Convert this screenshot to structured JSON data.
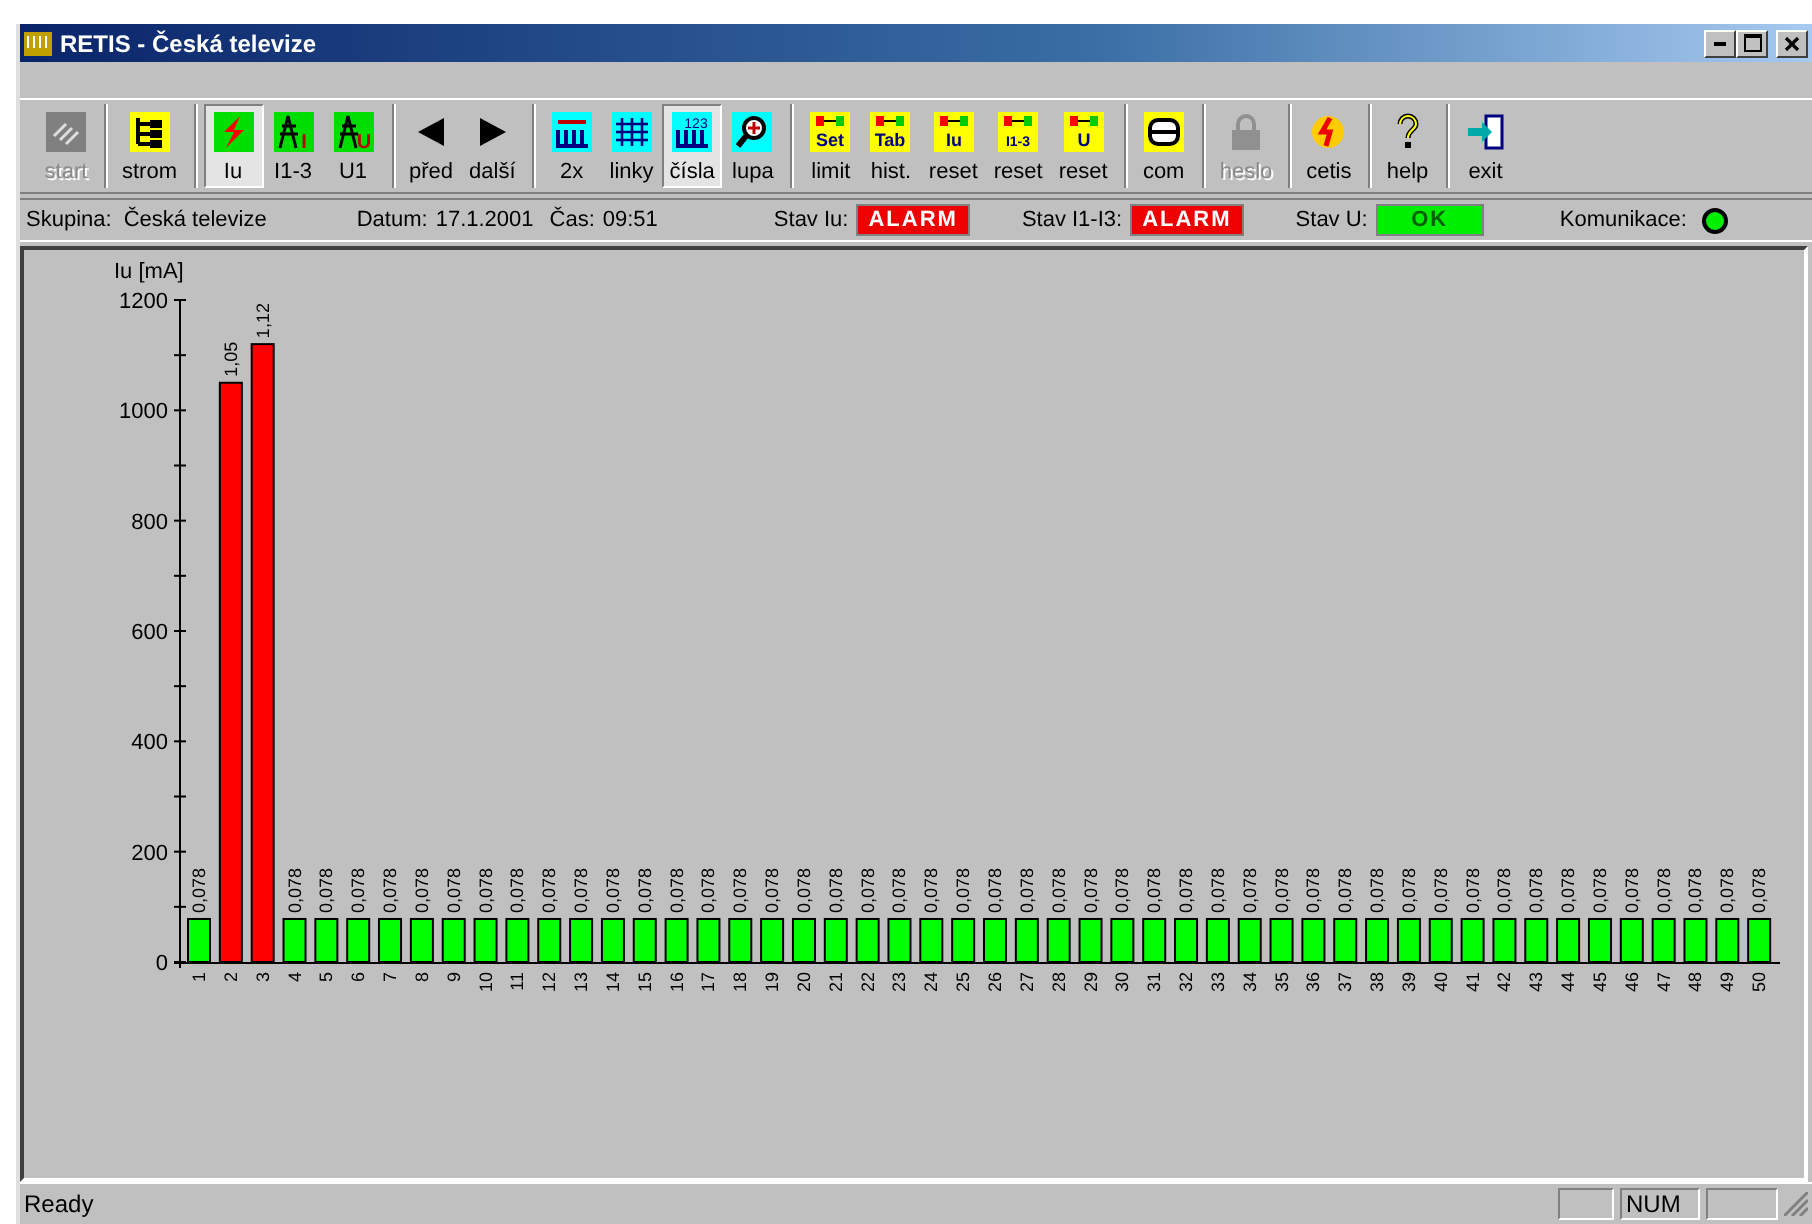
{
  "window": {
    "title": "RETIS - Česká televize"
  },
  "toolbar": [
    {
      "buttons": [
        {
          "label": "start",
          "pressed": false,
          "disabled": true
        }
      ]
    },
    {
      "buttons": [
        {
          "label": "strom",
          "pressed": false,
          "disabled": false
        }
      ]
    },
    {
      "buttons": [
        {
          "label": "Iu",
          "pressed": true,
          "disabled": false
        },
        {
          "label": "I1-3",
          "icon_text": "I",
          "pressed": false,
          "disabled": false
        },
        {
          "label": "U1",
          "icon_text": "U",
          "pressed": false,
          "disabled": false
        }
      ]
    },
    {
      "buttons": [
        {
          "label": "před",
          "pressed": false,
          "disabled": false
        },
        {
          "label": "další",
          "pressed": false,
          "disabled": false
        }
      ]
    },
    {
      "buttons": [
        {
          "label": "2x",
          "pressed": false,
          "disabled": false
        },
        {
          "label": "linky",
          "pressed": false,
          "disabled": false
        },
        {
          "label": "čísla",
          "icon_text": "123",
          "pressed": true,
          "disabled": false
        },
        {
          "label": "lupa",
          "pressed": false,
          "disabled": false
        }
      ]
    },
    {
      "buttons": [
        {
          "label": "limit",
          "icon_text": "Set",
          "pressed": false,
          "disabled": false
        },
        {
          "label": "hist.",
          "icon_text": "Tab",
          "pressed": false,
          "disabled": false
        },
        {
          "label": "reset",
          "icon_text": "Iu",
          "pressed": false,
          "disabled": false
        },
        {
          "label": "reset",
          "icon_text": "I1-3",
          "pressed": false,
          "disabled": false
        },
        {
          "label": "reset",
          "icon_text": "U",
          "pressed": false,
          "disabled": false
        }
      ]
    },
    {
      "buttons": [
        {
          "label": "com",
          "pressed": false,
          "disabled": false
        }
      ]
    },
    {
      "buttons": [
        {
          "label": "heslo",
          "pressed": false,
          "disabled": true
        }
      ]
    },
    {
      "buttons": [
        {
          "label": "cetis",
          "pressed": false,
          "disabled": false
        }
      ]
    },
    {
      "buttons": [
        {
          "label": "help",
          "pressed": false,
          "disabled": false
        }
      ]
    },
    {
      "buttons": [
        {
          "label": "exit",
          "pressed": false,
          "disabled": false
        }
      ]
    }
  ],
  "info_bar": {
    "group_label": "Skupina:",
    "group": "Česká televize",
    "date_label": "Datum:",
    "date": "17.1.2001",
    "time_label": "Čas:",
    "time": "09:51",
    "statuses": [
      {
        "label": "Stav Iu:",
        "value": "ALARM",
        "kind": "alarm"
      },
      {
        "label": "Stav I1-I3:",
        "value": "ALARM",
        "kind": "alarm"
      },
      {
        "label": "Stav U:",
        "value": "OK",
        "kind": "ok"
      }
    ],
    "communication_label": "Komunikace:",
    "communication_ok": true
  },
  "chart": {
    "chart_data": {
      "type": "bar",
      "ylabel": "Iu [mA]",
      "ylim": [
        0,
        1200
      ],
      "yticks": [
        0,
        200,
        400,
        600,
        800,
        1000,
        1200
      ],
      "categories": [
        "1",
        "2",
        "3",
        "4",
        "5",
        "6",
        "7",
        "8",
        "9",
        "10",
        "11",
        "12",
        "13",
        "14",
        "15",
        "16",
        "17",
        "18",
        "19",
        "20",
        "21",
        "22",
        "23",
        "24",
        "25",
        "26",
        "27",
        "28",
        "29",
        "30",
        "31",
        "32",
        "33",
        "34",
        "35",
        "36",
        "37",
        "38",
        "39",
        "40",
        "41",
        "42",
        "43",
        "44",
        "45",
        "46",
        "47",
        "48",
        "49",
        "50"
      ],
      "series": [
        {
          "color": "#00ff00",
          "values": [
            78,
            null,
            null,
            78,
            78,
            78,
            78,
            78,
            78,
            78,
            78,
            78,
            78,
            78,
            78,
            78,
            78,
            78,
            78,
            78,
            78,
            78,
            78,
            78,
            78,
            78,
            78,
            78,
            78,
            78,
            78,
            78,
            78,
            78,
            78,
            78,
            78,
            78,
            78,
            78,
            78,
            78,
            78,
            78,
            78,
            78,
            78,
            78,
            78,
            78
          ]
        },
        {
          "color": "#ff0000",
          "values": [
            null,
            1050,
            1120,
            null,
            null,
            null,
            null,
            null,
            null,
            null,
            null,
            null,
            null,
            null,
            null,
            null,
            null,
            null,
            null,
            null,
            null,
            null,
            null,
            null,
            null,
            null,
            null,
            null,
            null,
            null,
            null,
            null,
            null,
            null,
            null,
            null,
            null,
            null,
            null,
            null,
            null,
            null,
            null,
            null,
            null,
            null,
            null,
            null,
            null,
            null
          ]
        }
      ],
      "value_labels": [
        "0,078",
        "1,05",
        "1,12",
        "0,078",
        "0,078",
        "0,078",
        "0,078",
        "0,078",
        "0,078",
        "0,078",
        "0,078",
        "0,078",
        "0,078",
        "0,078",
        "0,078",
        "0,078",
        "0,078",
        "0,078",
        "0,078",
        "0,078",
        "0,078",
        "0,078",
        "0,078",
        "0,078",
        "0,078",
        "0,078",
        "0,078",
        "0,078",
        "0,078",
        "0,078",
        "0,078",
        "0,078",
        "0,078",
        "0,078",
        "0,078",
        "0,078",
        "0,078",
        "0,078",
        "0,078",
        "0,078",
        "0,078",
        "0,078",
        "0,078",
        "0,078",
        "0,078",
        "0,078",
        "0,078",
        "0,078",
        "0,078",
        "0,078"
      ]
    }
  },
  "status_bar": {
    "text": "Ready",
    "indicators": [
      {
        "label": "NUM"
      }
    ]
  }
}
